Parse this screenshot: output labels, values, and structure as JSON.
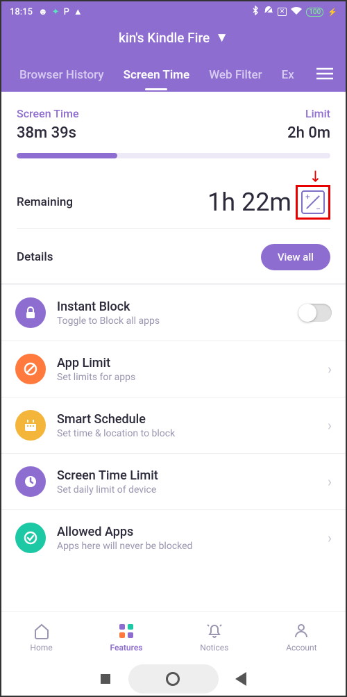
{
  "status": {
    "time": "18:15",
    "battery": "100"
  },
  "header": {
    "device": "kin's Kindle Fire",
    "tabs": [
      "Browser History",
      "Screen Time",
      "Web Filter",
      "Ex"
    ]
  },
  "screen_time": {
    "label": "Screen Time",
    "value": "38m 39s",
    "limit_label": "Limit",
    "limit_value": "2h 0m",
    "progress_percent": 32,
    "remaining_label": "Remaining",
    "remaining_value": "1h 22m",
    "details_label": "Details",
    "viewall_label": "View all"
  },
  "settings": [
    {
      "title": "Instant Block",
      "sub": "Toggle to Block all apps",
      "icon": "lock",
      "color": "#8e6dd0",
      "action": "toggle"
    },
    {
      "title": "App Limit",
      "sub": "Set limits for apps",
      "icon": "no",
      "color": "#ff7a3c",
      "action": "chevron"
    },
    {
      "title": "Smart Schedule",
      "sub": "Set time & location to block",
      "icon": "calendar",
      "color": "#f3b53a",
      "action": "chevron"
    },
    {
      "title": "Screen Time Limit",
      "sub": "Set daily limit of device",
      "icon": "clock",
      "color": "#8e6dd0",
      "action": "chevron"
    },
    {
      "title": "Allowed Apps",
      "sub": "Apps here will never be blocked",
      "icon": "check",
      "color": "#1dc8a5",
      "action": "chevron"
    }
  ],
  "tabbar": {
    "items": [
      {
        "label": "Home",
        "icon": "home"
      },
      {
        "label": "Features",
        "icon": "features"
      },
      {
        "label": "Notices",
        "icon": "bell"
      },
      {
        "label": "Account",
        "icon": "person"
      }
    ],
    "active": 1
  }
}
